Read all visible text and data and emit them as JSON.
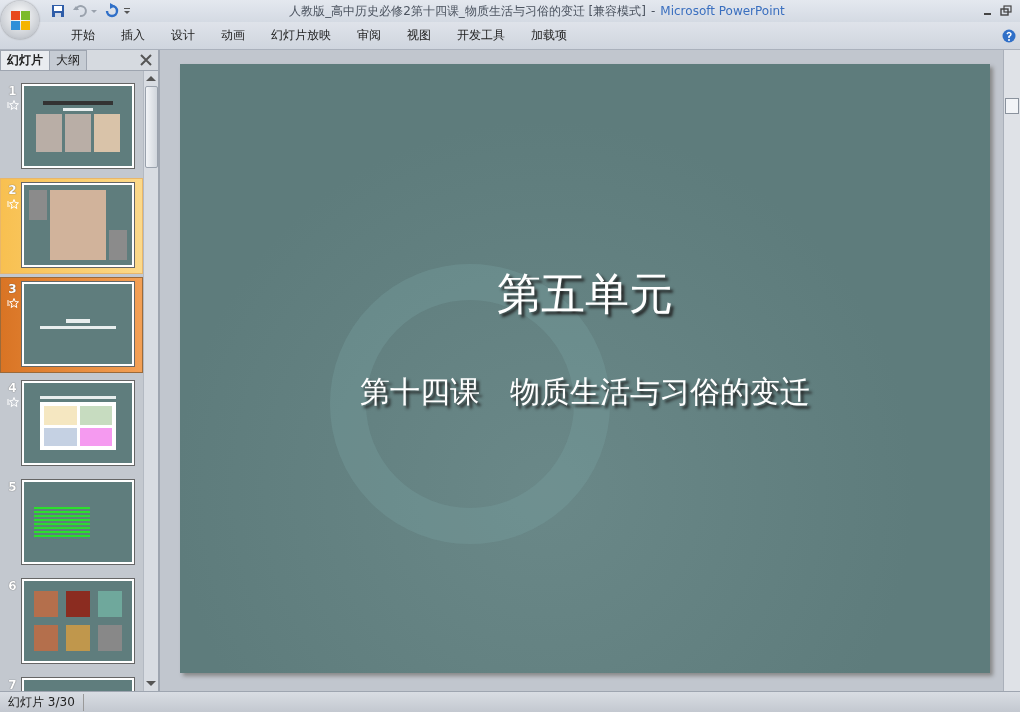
{
  "window": {
    "title": "人教版_高中历史必修2第十四课_物质生活与习俗的变迁 [兼容模式]",
    "separator": "-",
    "app_name": "Microsoft PowerPoint"
  },
  "ribbon_tabs": [
    {
      "label": "开始",
      "selected": false
    },
    {
      "label": "插入",
      "selected": false
    },
    {
      "label": "设计",
      "selected": false
    },
    {
      "label": "动画",
      "selected": false
    },
    {
      "label": "幻灯片放映",
      "selected": false
    },
    {
      "label": "审阅",
      "selected": false
    },
    {
      "label": "视图",
      "selected": false
    },
    {
      "label": "开发工具",
      "selected": false
    },
    {
      "label": "加载项",
      "selected": false
    }
  ],
  "panel_tabs": [
    {
      "label": "幻灯片",
      "selected": true
    },
    {
      "label": "大纲",
      "selected": false
    }
  ],
  "slides": [
    {
      "number": "1",
      "kind": "photos",
      "animated": true,
      "selected": false,
      "hovered": false
    },
    {
      "number": "2",
      "kind": "poster",
      "animated": true,
      "selected": false,
      "hovered": true
    },
    {
      "number": "3",
      "kind": "title",
      "animated": true,
      "selected": true,
      "hovered": false
    },
    {
      "number": "4",
      "kind": "calligraphy",
      "animated": true,
      "selected": false,
      "hovered": false
    },
    {
      "number": "5",
      "kind": "text",
      "animated": false,
      "selected": false,
      "hovered": false
    },
    {
      "number": "6",
      "kind": "grid",
      "animated": false,
      "selected": false,
      "hovered": false
    },
    {
      "number": "7",
      "kind": "heading",
      "animated": false,
      "selected": false,
      "hovered": false
    }
  ],
  "current_slide": {
    "title": "第五单元",
    "subtitle": "第十四课　物质生活与习俗的变迁"
  },
  "status_bar": {
    "slide_info": "幻灯片 3/30"
  }
}
